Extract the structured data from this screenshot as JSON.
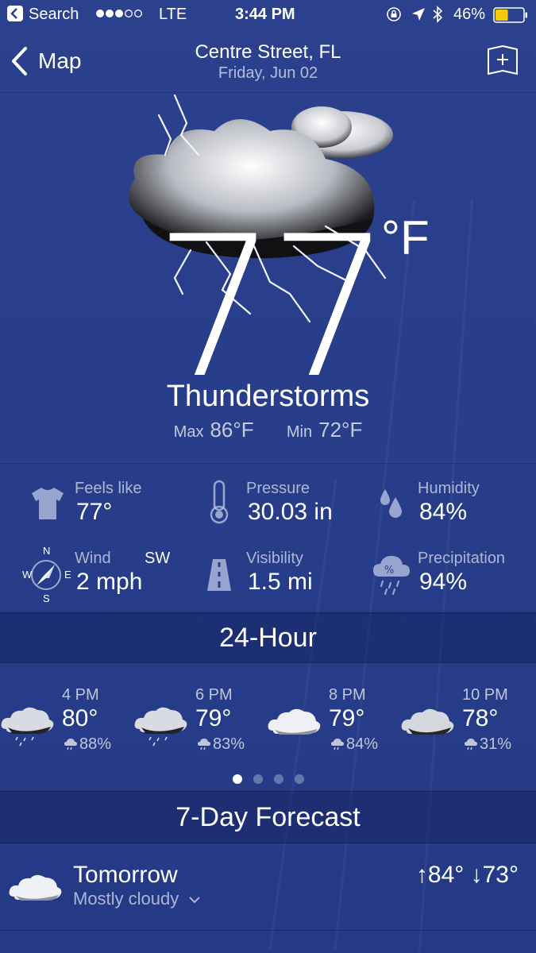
{
  "status_bar": {
    "back_app": "Search",
    "carrier": "LTE",
    "time": "3:44 PM",
    "battery": "46%",
    "battery_level": 0.46
  },
  "header": {
    "back_label": "Map",
    "location": "Centre Street, FL",
    "date": "Friday, Jun 02"
  },
  "current": {
    "temperature": "77",
    "unit": "°F",
    "condition": "Thunderstorms",
    "max_label": "Max",
    "max_value": "86°F",
    "min_label": "Min",
    "min_value": "72°F"
  },
  "details": {
    "feels_like": {
      "label": "Feels like",
      "value": "77°"
    },
    "pressure": {
      "label": "Pressure",
      "value": "30.03 in"
    },
    "humidity": {
      "label": "Humidity",
      "value": "84%"
    },
    "wind": {
      "label": "Wind",
      "direction": "SW",
      "value": "2 mph",
      "compass": [
        "N",
        "E",
        "S",
        "W"
      ]
    },
    "visibility": {
      "label": "Visibility",
      "value": "1.5 mi"
    },
    "precipitation": {
      "label": "Precipitation",
      "value": "94%"
    }
  },
  "hourly": {
    "title": "24-Hour",
    "items": [
      {
        "time": "4 PM",
        "temp": "80°",
        "precip": "88%",
        "icon": "rain-cloud-icon"
      },
      {
        "time": "6 PM",
        "temp": "79°",
        "precip": "83%",
        "icon": "rain-cloud-icon"
      },
      {
        "time": "8 PM",
        "temp": "79°",
        "precip": "84%",
        "icon": "cloud-icon"
      },
      {
        "time": "10 PM",
        "temp": "78°",
        "precip": "31%",
        "icon": "dark-cloud-icon"
      }
    ],
    "page_count": 4,
    "active_page": 1
  },
  "daily": {
    "title": "7-Day Forecast",
    "items": [
      {
        "day": "Tomorrow",
        "condition": "Mostly cloudy",
        "high": "↑84°",
        "low": "↓73°",
        "icon": "cloud-icon"
      }
    ]
  },
  "colors": {
    "background": "#283e8b",
    "battery_fill": "#f6c90e",
    "text": "#ffffff"
  }
}
